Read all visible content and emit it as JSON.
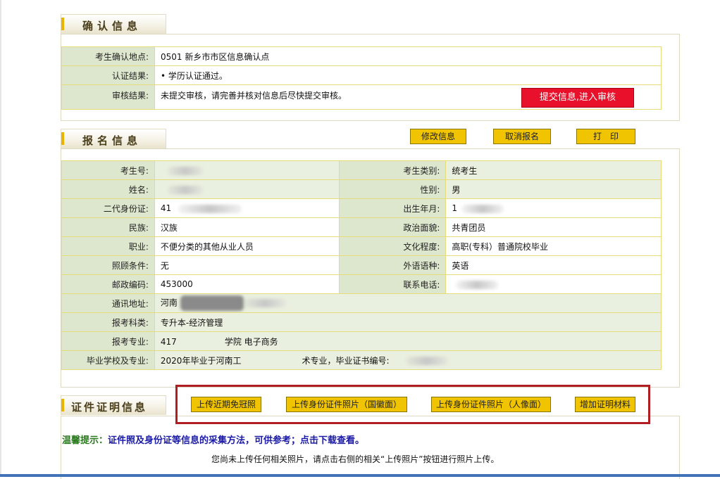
{
  "confirm": {
    "title": "确认信息",
    "location_label": "考生确认地点:",
    "location_value": "0501   新乡市市区信息确认点",
    "cert_label": "认证结果:",
    "cert_value": "•  学历认证通过。",
    "review_label": "审核结果:",
    "review_value": "未提交审核，请完善并核对信息后尽快提交审核。",
    "submit_button": "提交信息,进入审核"
  },
  "registration": {
    "title": "报名信息",
    "buttons": {
      "modify": "修改信息",
      "cancel": "取消报名",
      "print": "打　印"
    },
    "rows": [
      {
        "l1": "考生号:",
        "v1": "",
        "l2": "考生类别:",
        "v2": "统考生"
      },
      {
        "l1": "姓名:",
        "v1": "",
        "l2": "性别:",
        "v2": "男"
      },
      {
        "l1": "二代身份证:",
        "v1": "41",
        "l2": "出生年月:",
        "v2": "1"
      },
      {
        "l1": "民族:",
        "v1": "汉族",
        "l2": "政治面貌:",
        "v2": "共青团员"
      },
      {
        "l1": "职业:",
        "v1": "不便分类的其他从业人员",
        "l2": "文化程度:",
        "v2": "高职(专科）普通院校毕业"
      },
      {
        "l1": "照顾条件:",
        "v1": "无",
        "l2": "外语语种:",
        "v2": "英语"
      },
      {
        "l1": "邮政编码:",
        "v1": "453000",
        "l2": "联系电话:",
        "v2": ""
      }
    ],
    "address_label": "通讯地址:",
    "address_value": "河南",
    "subject_label": "报考科类:",
    "subject_value": "专升本-经济管理",
    "major_label": "报考专业:",
    "major_value": "417",
    "major_value_suffix": "学院 电子商务",
    "school_label": "毕业学校及专业:",
    "school_value": "2020年毕业于河南工",
    "school_value_suffix": "术专业，毕业证书编号:"
  },
  "certificates": {
    "title": "证件证明信息",
    "buttons": {
      "upload_photo": "上传近期免冠照",
      "upload_id_emblem": "上传身份证件照片（国徽面）",
      "upload_id_portrait": "上传身份证件照片（人像面）",
      "add_material": "增加证明材料"
    },
    "tip_prefix": "温馨提示：",
    "tip_text": "证件照及身份证等信息的采集方法，可供参考；点击下载查看。",
    "notice": "您尚未上传任何相关照片，请点击右侧的相关“上传照片”按钮进行照片上传。"
  }
}
